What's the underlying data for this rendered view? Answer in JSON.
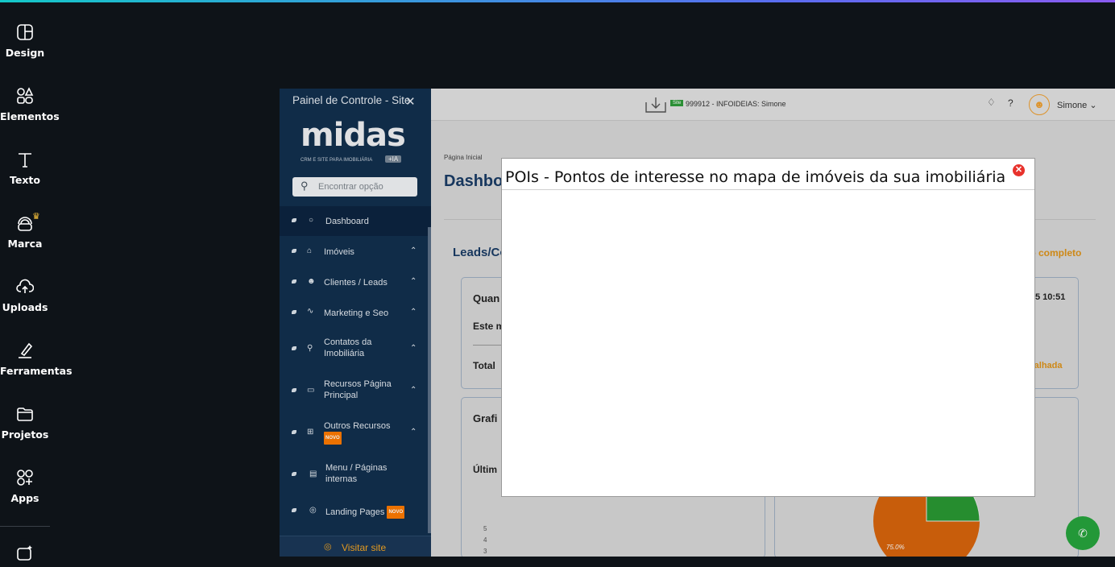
{
  "rail": {
    "items": [
      {
        "label": "Design",
        "icon": "layout-icon"
      },
      {
        "label": "Elementos",
        "icon": "shapes-icon"
      },
      {
        "label": "Texto",
        "icon": "text-icon"
      },
      {
        "label": "Marca",
        "icon": "brand-icon"
      },
      {
        "label": "Uploads",
        "icon": "upload-cloud-icon"
      },
      {
        "label": "Ferramentas",
        "icon": "draw-tool-icon"
      },
      {
        "label": "Projetos",
        "icon": "folder-icon"
      },
      {
        "label": "Apps",
        "icon": "apps-icon"
      }
    ]
  },
  "sidebar": {
    "header": "Painel de Controle - Site",
    "close": "✕",
    "logo_word": "midas",
    "logo_sub": "CRM E SITE PARA IMOBILIÁRIA",
    "logo_ia": "+IA",
    "search_placeholder": "Encontrar opção",
    "items": [
      {
        "label": "Dashboard"
      },
      {
        "label": "Imóveis"
      },
      {
        "label": "Clientes / Leads"
      },
      {
        "label": "Marketing e Seo"
      },
      {
        "label": "Contatos da",
        "label2": "Imobiliária"
      },
      {
        "label": "Recursos Página",
        "label2": "Principal"
      },
      {
        "label": "Outros Recursos",
        "badge": "NOVO"
      },
      {
        "label": "Menu / Páginas",
        "label2": "internas"
      },
      {
        "label": "Landing Pages",
        "badge": "NOVO"
      }
    ],
    "visit": "Visitar site"
  },
  "topbar": {
    "tag": "Site",
    "account": "999912 - INFOIDEIAS: Simone",
    "help": "?",
    "user": "Simone"
  },
  "page": {
    "crumb": "Página Inicial",
    "title": "Dashboa",
    "section": "Leads/Co",
    "section_link": "io completo",
    "card1": {
      "title": "Quan",
      "time": "5 10:51",
      "row1": "Este m",
      "row2": "Total",
      "link": "talhada"
    },
    "card2": {
      "title": "Grafi",
      "sub": "Últim"
    },
    "axis": [
      "5",
      "4",
      "3"
    ],
    "pie_label": "75.0%",
    "colors": {
      "pie_main": "#d9650c",
      "pie_slice": "#2a9a34"
    }
  },
  "modal": {
    "title": "POIs - Pontos de interesse no mapa de imóveis da sua imobiliária",
    "close": "✕"
  }
}
